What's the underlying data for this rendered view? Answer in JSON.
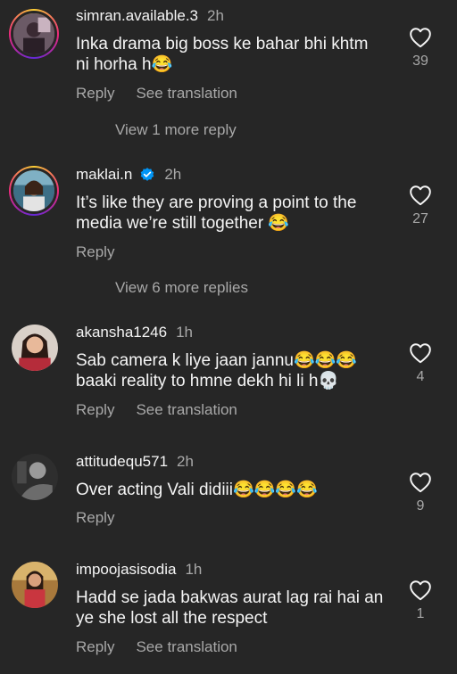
{
  "comments": [
    {
      "username": "simran.available.3",
      "time": "2h",
      "text": "Inka drama big boss ke bahar bhi khtm ni horha h😂",
      "likes": "39",
      "reply": "Reply",
      "translate": "See translation"
    },
    {
      "username": "maklai.n",
      "time": "2h",
      "text": "It’s like they are proving a point to the media we’re still together 😂",
      "likes": "27",
      "reply": "Reply"
    },
    {
      "username": "akansha1246",
      "time": "1h",
      "text": "Sab camera k liye jaan jannu😂😂😂 baaki reality to hmne dekh hi li h💀",
      "likes": "4",
      "reply": "Reply",
      "translate": "See translation"
    },
    {
      "username": "attitudequ571",
      "time": "2h",
      "text": "Over acting Vali didiii😂😂😂😂",
      "likes": "9",
      "reply": "Reply"
    },
    {
      "username": "impoojasisodia",
      "time": "1h",
      "text": "Hadd se jada bakwas aurat lag rai hai an ye she lost all the respect",
      "likes": "1",
      "reply": "Reply",
      "translate": "See translation"
    }
  ],
  "view_more": [
    "View 1 more reply",
    "View 6 more replies"
  ],
  "colors": {
    "background": "#262626",
    "secondary_text": "#a8a8a8",
    "verified_blue": "#0095f6"
  },
  "icons": {
    "like": "heart-outline-icon",
    "verified": "verified-badge-icon"
  }
}
